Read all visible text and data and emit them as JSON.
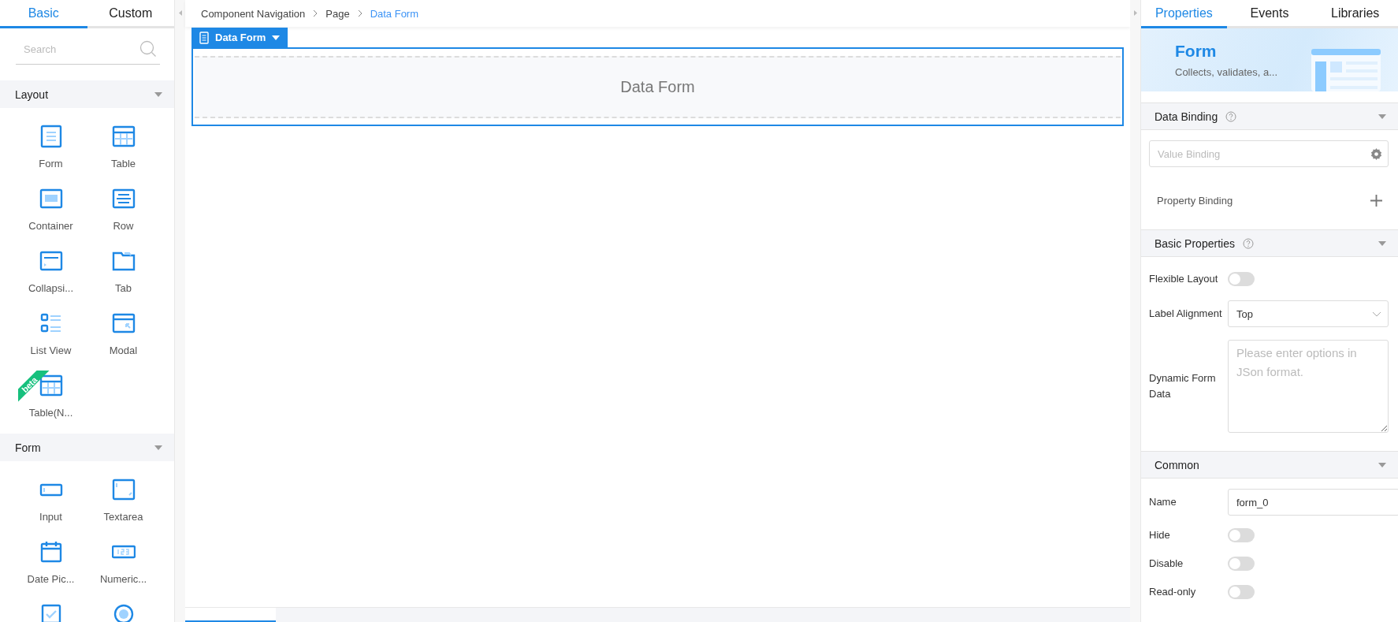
{
  "left_panel": {
    "tabs": [
      {
        "label": "Basic",
        "selected": true
      },
      {
        "label": "Custom",
        "selected": false
      }
    ],
    "search": {
      "placeholder": "Search"
    },
    "sections": [
      {
        "title": "Layout",
        "items": [
          {
            "kind": "form",
            "label": "Form"
          },
          {
            "kind": "table",
            "label": "Table"
          },
          {
            "kind": "container",
            "label": "Container"
          },
          {
            "kind": "row",
            "label": "Row"
          },
          {
            "kind": "collapse",
            "label": "Collapsi..."
          },
          {
            "kind": "tab",
            "label": "Tab"
          },
          {
            "kind": "list",
            "label": "List View"
          },
          {
            "kind": "modal",
            "label": "Modal"
          },
          {
            "kind": "table",
            "label": "Table(N...",
            "badge": "beta"
          }
        ]
      },
      {
        "title": "Form",
        "items": [
          {
            "kind": "input",
            "label": "Input"
          },
          {
            "kind": "textarea",
            "label": "Textarea"
          },
          {
            "kind": "date",
            "label": "Date Pic..."
          },
          {
            "kind": "numeric",
            "label": "Numeric..."
          },
          {
            "kind": "checkbox"
          },
          {
            "kind": "radio"
          }
        ]
      }
    ]
  },
  "canvas": {
    "breadcrumb": [
      "Component Navigation",
      "Page",
      "Data Form"
    ],
    "component": {
      "tag": "Data Form",
      "placeholder": "Data Form"
    }
  },
  "right_panel": {
    "tabs": [
      {
        "label": "Properties",
        "selected": true
      },
      {
        "label": "Events",
        "selected": false
      },
      {
        "label": "Libraries",
        "selected": false
      }
    ],
    "banner": {
      "title": "Form",
      "description": "Collects, validates, a..."
    },
    "sections": [
      {
        "title": "Data Binding",
        "help": true,
        "fields": [
          {
            "kind": "binding",
            "placeholder": "Value Binding"
          },
          {
            "kind": "add",
            "label": "Property Binding"
          }
        ]
      },
      {
        "title": "Basic Properties",
        "help": true,
        "fields": [
          {
            "kind": "switch",
            "label": "Flexible Layout",
            "on": false
          },
          {
            "kind": "select",
            "label": "Label Alignment",
            "value": "Top"
          },
          {
            "kind": "textarea",
            "label": "Dynamic Form Data",
            "placeholder": "Please enter options in JSon format."
          }
        ]
      },
      {
        "title": "Common",
        "help": false,
        "fields": [
          {
            "kind": "text",
            "label": "Name",
            "value": "form_0"
          },
          {
            "kind": "switch",
            "label": "Hide",
            "on": false
          },
          {
            "kind": "switch",
            "label": "Disable",
            "on": false
          },
          {
            "kind": "switch",
            "label": "Read-only",
            "on": false
          }
        ]
      }
    ]
  }
}
